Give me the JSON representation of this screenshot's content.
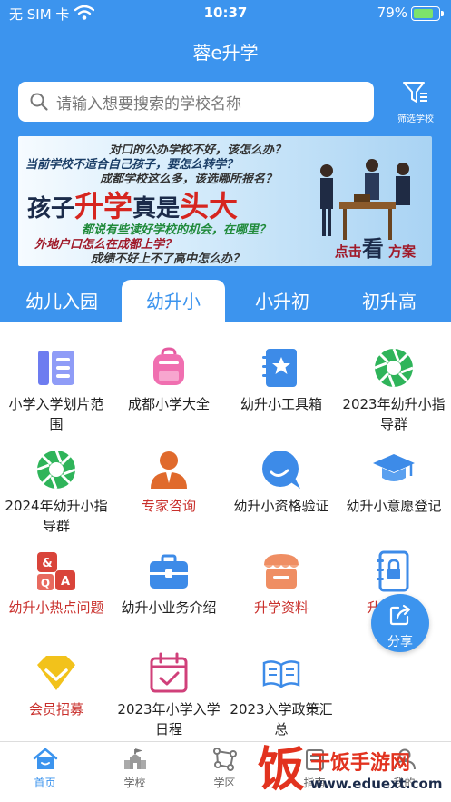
{
  "status_bar": {
    "carrier": "无 SIM 卡",
    "time": "10:37",
    "battery": "79%"
  },
  "app_title": "蓉e升学",
  "search": {
    "placeholder": "请输入想要搜索的学校名称"
  },
  "filter": {
    "label": "筛选学校"
  },
  "banner": {
    "line1": "对口的公办学校不好，该怎么办？",
    "line2": "当前学校不适合自己孩子，要怎么转学？",
    "line3": "成都学校这么多，该选哪所报名？",
    "headline_a": "孩子",
    "headline_b": "升学",
    "headline_c": "真是",
    "headline_d": "头大",
    "line4": "都说有些读好学校的机会，在哪里？",
    "line5": "外地户口怎么在成都上学？",
    "line6": "成绩不好上不了高中怎么办？",
    "cta_a": "点击",
    "cta_b": "看",
    "cta_c": "方案"
  },
  "tabs": [
    "幼儿入园",
    "幼升小",
    "小升初",
    "初升高"
  ],
  "active_tab": 1,
  "grid": [
    {
      "label": "小学入学划片范围",
      "icon": "document-list-icon",
      "highlight": false
    },
    {
      "label": "成都小学大全",
      "icon": "backpack-icon",
      "highlight": false
    },
    {
      "label": "幼升小工具箱",
      "icon": "star-notebook-icon",
      "highlight": false
    },
    {
      "label": "2023年幼升小指导群",
      "icon": "aperture-icon",
      "highlight": false
    },
    {
      "label": "2024年幼升小指导群",
      "icon": "aperture-icon",
      "highlight": false
    },
    {
      "label": "专家咨询",
      "icon": "expert-person-icon",
      "highlight": true
    },
    {
      "label": "幼升小资格验证",
      "icon": "chat-bubble-icon",
      "highlight": false
    },
    {
      "label": "幼升小意愿登记",
      "icon": "graduation-cap-icon",
      "highlight": false
    },
    {
      "label": "幼升小热点问题",
      "icon": "qa-icon",
      "highlight": true
    },
    {
      "label": "幼升小业务介绍",
      "icon": "briefcase-icon",
      "highlight": false
    },
    {
      "label": "升学资料",
      "icon": "storefront-icon",
      "highlight": true
    },
    {
      "label": "升学手册",
      "icon": "locked-book-icon",
      "highlight": true
    },
    {
      "label": "会员招募",
      "icon": "diamond-icon",
      "highlight": true
    },
    {
      "label": "2023年小学入学日程",
      "icon": "calendar-check-icon",
      "highlight": false
    },
    {
      "label": "2023入学政策汇总",
      "icon": "open-book-icon",
      "highlight": false
    }
  ],
  "share": {
    "label": "分享"
  },
  "tabbar": [
    {
      "label": "首页",
      "icon": "home-icon"
    },
    {
      "label": "学校",
      "icon": "school-icon"
    },
    {
      "label": "学区",
      "icon": "district-icon"
    },
    {
      "label": "指南",
      "icon": "guide-icon"
    },
    {
      "label": "我的",
      "icon": "profile-icon"
    }
  ],
  "active_tabbar": 0,
  "watermark": {
    "char": "饭",
    "title": "干饭手游网",
    "url": "www.eduext.com"
  },
  "colors": {
    "primary": "#3c94ee",
    "highlight_text": "#c9302c",
    "watermark": "#e2331f"
  }
}
